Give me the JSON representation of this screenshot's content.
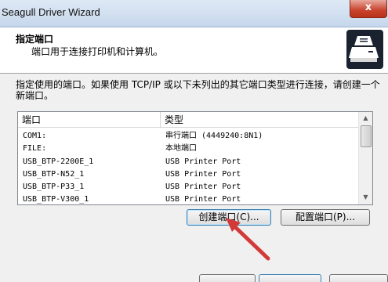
{
  "window": {
    "title": "Seagull Driver Wizard",
    "close_label": "x"
  },
  "header": {
    "title": "指定端口",
    "subtitle": "端口用于连接打印机和计算机。",
    "icon": "printer-icon"
  },
  "description": "指定使用的端口。如果使用 TCP/IP 或以下未列出的其它端口类型进行连接，请创建一个新端口。",
  "port_list": {
    "columns": [
      "端口",
      "类型"
    ],
    "rows": [
      {
        "port": "COM1:",
        "type": "串行端口 (4449240:8N1)"
      },
      {
        "port": "FILE:",
        "type": "本地端口"
      },
      {
        "port": "USB_BTP-2200E_1",
        "type": "USB Printer Port"
      },
      {
        "port": "USB_BTP-N52_1",
        "type": "USB Printer Port"
      },
      {
        "port": "USB_BTP-P33_1",
        "type": "USB Printer Port"
      },
      {
        "port": "USB_BTP-V300_1",
        "type": "USB Printer Port"
      }
    ]
  },
  "buttons": {
    "create_port": "创建端口(C)...",
    "configure_port": "配置端口(P)..."
  },
  "colors": {
    "annotation_arrow": "#d23a3a",
    "close_button": "#c8422c",
    "titlebar": "#c6d7ec"
  }
}
